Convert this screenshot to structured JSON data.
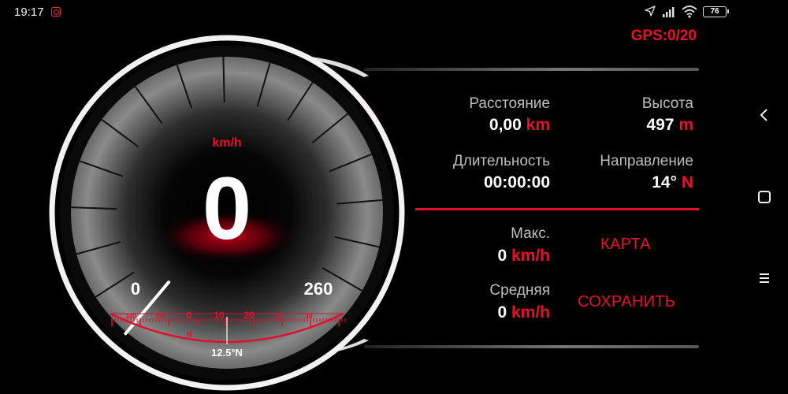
{
  "status_bar": {
    "time": "19:17",
    "battery": "76",
    "icons": [
      "app-notification-icon",
      "location-arrow-icon",
      "signal-bars-icon",
      "wifi-icon",
      "battery-icon"
    ]
  },
  "gps": {
    "status": "GPS:0/20"
  },
  "speedometer": {
    "unit": "km/h",
    "speed": "0",
    "min_label": "0",
    "max_label": "260",
    "needle_value": 0,
    "max_value": 260,
    "compass": {
      "tick_labels": [
        "340",
        "350",
        "0",
        "10",
        "20",
        "30",
        "40"
      ],
      "north_label": "N",
      "heading": "12.5°N"
    }
  },
  "stats": {
    "distance": {
      "label": "Расстояние",
      "value": "0,00",
      "unit": "km"
    },
    "altitude": {
      "label": "Высота",
      "value": "497",
      "unit": "m"
    },
    "duration": {
      "label": "Длительность",
      "value": "00:00:00"
    },
    "direction": {
      "label": "Направление",
      "value": "14°",
      "unit": "N"
    },
    "max_speed": {
      "label": "Макс.",
      "value": "0",
      "unit": "km/h"
    },
    "avg_speed": {
      "label": "Средняя",
      "value": "0",
      "unit": "km/h"
    }
  },
  "actions": {
    "map_label": "КАРТА",
    "save_label": "СОХРАНИТЬ"
  },
  "colors": {
    "accent_red": "#e8102a",
    "background": "#000000",
    "text_primary": "#ffffff",
    "text_secondary": "#bdbdbd"
  },
  "nav_bar": {
    "icons": [
      "back-chevron-icon",
      "home-square-icon",
      "menu-lines-icon"
    ]
  }
}
